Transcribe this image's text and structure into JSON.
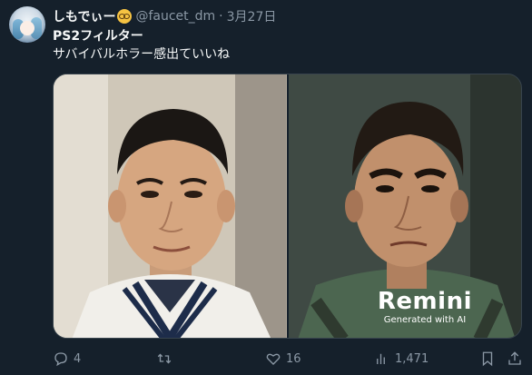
{
  "tweet": {
    "display_name": "しもでぃー",
    "emoji": "🤓",
    "handle": "@faucet_dm",
    "separator": "·",
    "date": "3月27日",
    "text_line1": "PS2フィルター",
    "text_line2": "サバイバルホラー感出ていいね"
  },
  "media": {
    "left_image": "photo-portrait",
    "right_image": "ps2-filtered-portrait",
    "watermark_logo": "Remini",
    "watermark_caption": "Generated with AI"
  },
  "actions": {
    "reply_count": "4",
    "retweet_count": "",
    "like_count": "16",
    "view_count": "1,471",
    "icons": [
      "reply-icon",
      "retweet-icon",
      "like-icon",
      "views-icon",
      "bookmark-icon",
      "share-icon"
    ]
  },
  "colors": {
    "background": "#15202b",
    "text_primary": "#f7f9f9",
    "text_secondary": "#8b98a5",
    "border": "#38444d"
  }
}
